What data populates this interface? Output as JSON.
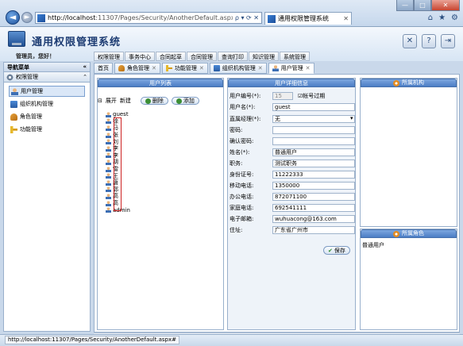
{
  "browser": {
    "url_host": "http://localhost",
    "url_rest": ":11307/Pages/Security/AnotherDefault.aspx#",
    "address_tools": "ρ ▾ ⟳ ✕",
    "tab_title": "通用权限管理系统",
    "tab_close": "✕",
    "min_label": "—",
    "max_label": "□",
    "close_label": "✕",
    "icons": [
      "home-icon",
      "star-icon",
      "gear-icon"
    ]
  },
  "app": {
    "title": "通用权限管理系统",
    "welcome": "管理员，您好！",
    "menu": [
      "权限管理",
      "事务中心",
      "合同起草",
      "合同管理",
      "查询打印",
      "知识管理",
      "系统管理"
    ]
  },
  "nav": {
    "header": "导航菜单",
    "header_arrow": "«",
    "group": "权限管理",
    "group_arrow": "⌃",
    "items": [
      {
        "label": "用户管理",
        "icon": "user-icon"
      },
      {
        "label": "组织机构管理",
        "icon": "org-icon"
      },
      {
        "label": "角色管理",
        "icon": "role-icon"
      },
      {
        "label": "功能管理",
        "icon": "key-icon"
      }
    ]
  },
  "tabs": [
    {
      "label": "首页",
      "closable": false
    },
    {
      "label": "角色管理",
      "closable": true
    },
    {
      "label": "功能管理",
      "closable": true
    },
    {
      "label": "组织机构管理",
      "closable": true
    },
    {
      "label": "用户管理",
      "closable": true
    }
  ],
  "user_list": {
    "title": "用户列表",
    "expand_label": "展开",
    "new_label": "新建",
    "delete_label": "删除",
    "add_label": "添加",
    "users": [
      "guest",
      "徐",
      "马",
      "张",
      "刘",
      "李",
      "李",
      "胡",
      "雷",
      "王",
      "唐",
      "郭",
      "高",
      "高",
      "admin"
    ]
  },
  "detail": {
    "title": "用户详细信息",
    "fields": [
      {
        "label": "用户编号(*):",
        "value": "15"
      },
      {
        "label": "用户名(*):",
        "value": "guest"
      },
      {
        "label": "直属经理(*):",
        "value": "无"
      },
      {
        "label": "密码:",
        "value": ""
      },
      {
        "label": "确认密码:",
        "value": ""
      },
      {
        "label": "姓名(*):",
        "value": "普通用户"
      },
      {
        "label": "职务:",
        "value": "测试职务"
      },
      {
        "label": "身份证号:",
        "value": "11222333"
      },
      {
        "label": "移动电话:",
        "value": "1350000"
      },
      {
        "label": "办公电话:",
        "value": "872071100"
      },
      {
        "label": "家庭电话:",
        "value": "692541111"
      },
      {
        "label": "电子邮箱:",
        "value": "wuhuacong@163.com"
      },
      {
        "label": "住址:",
        "value": "广东省广州市"
      }
    ],
    "expired_label": "帐号过期",
    "save_label": "保存"
  },
  "org_panel": {
    "title": "所属机构"
  },
  "role_panel": {
    "title": "所属角色",
    "items": [
      "普通用户"
    ]
  },
  "status": {
    "url": "http://localhost:11307/Pages/Security/AnotherDefault.aspx#"
  }
}
